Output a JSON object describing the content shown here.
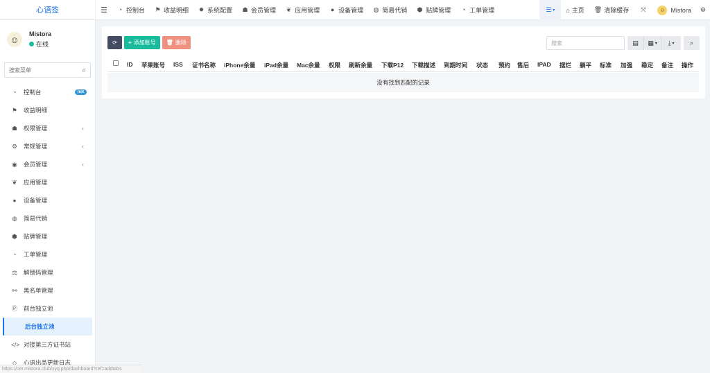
{
  "brand": "心语签",
  "top_nav": [
    {
      "icon": "dashboard-icon",
      "glyph": "◔",
      "label": "控制台"
    },
    {
      "icon": "flag-icon",
      "glyph": "⚑",
      "label": "收益明细"
    },
    {
      "icon": "gear-icon",
      "glyph": "✹",
      "label": "系统配置"
    },
    {
      "icon": "users-icon",
      "glyph": "☗",
      "label": "会员管理"
    },
    {
      "icon": "leaf-icon",
      "glyph": "❦",
      "label": "应用管理"
    },
    {
      "icon": "circle-icon",
      "glyph": "●",
      "label": "设备管理"
    },
    {
      "icon": "dribbble-icon",
      "glyph": "◍",
      "label": "简易代销"
    },
    {
      "icon": "tags-icon",
      "glyph": "⬢",
      "label": "贴牌管理"
    },
    {
      "icon": "dashboard-icon",
      "glyph": "◔",
      "label": "工单管理"
    }
  ],
  "top_right": {
    "home_label": "主页",
    "clear_cache_label": "清除缓存",
    "username": "Mistora"
  },
  "user": {
    "name": "Mistora",
    "status": "在线"
  },
  "sidebar_search": {
    "placeholder": "搜索菜单"
  },
  "sidebar_items": [
    {
      "icon": "dashboard-icon",
      "glyph": "◔",
      "label": "控制台",
      "badge": "hot",
      "arrow": ""
    },
    {
      "icon": "flag-icon",
      "glyph": "⚑",
      "label": "收益明细",
      "badge": "",
      "arrow": ""
    },
    {
      "icon": "users-icon",
      "glyph": "☗",
      "label": "权限管理",
      "badge": "",
      "arrow": "‹"
    },
    {
      "icon": "cogs-icon",
      "glyph": "⚙",
      "label": "常规管理",
      "badge": "",
      "arrow": "‹"
    },
    {
      "icon": "user-circle-icon",
      "glyph": "◉",
      "label": "会员管理",
      "badge": "",
      "arrow": "‹"
    },
    {
      "icon": "leaf-icon",
      "glyph": "❦",
      "label": "应用管理",
      "badge": "",
      "arrow": ""
    },
    {
      "icon": "circle-icon",
      "glyph": "●",
      "label": "设备管理",
      "badge": "",
      "arrow": ""
    },
    {
      "icon": "dribbble-icon",
      "glyph": "◍",
      "label": "简易代销",
      "badge": "",
      "arrow": ""
    },
    {
      "icon": "tags-icon",
      "glyph": "⬢",
      "label": "贴牌管理",
      "badge": "",
      "arrow": ""
    },
    {
      "icon": "dashboard-icon",
      "glyph": "◔",
      "label": "工单管理",
      "badge": "",
      "arrow": ""
    },
    {
      "icon": "balance-scale-icon",
      "glyph": "⚖",
      "label": "解锁码管理",
      "badge": "",
      "arrow": ""
    },
    {
      "icon": "bicycle-icon",
      "glyph": "⚯",
      "label": "黑名单管理",
      "badge": "",
      "arrow": ""
    },
    {
      "icon": "product-hunt-icon",
      "glyph": "Ⓟ",
      "label": "前台独立池",
      "badge": "",
      "arrow": ""
    },
    {
      "icon": "apple-icon",
      "glyph": "",
      "label": "后台独立池",
      "badge": "",
      "arrow": "",
      "active": true
    },
    {
      "icon": "code-icon",
      "glyph": "</>",
      "label": "对接第三方证书站",
      "badge": "",
      "arrow": ""
    },
    {
      "icon": "code-fork-icon",
      "glyph": "◇",
      "label": "心语出品更新日志",
      "badge": "",
      "arrow": ""
    }
  ],
  "toolbar": {
    "add_label": "添加账号",
    "delete_label": "删除",
    "search_placeholder": "搜索"
  },
  "table": {
    "columns": [
      "ID",
      "苹果账号",
      "ISS",
      "证书名称",
      "iPhone余量",
      "iPad余量",
      "Mac余量",
      "权限",
      "刷新余量",
      "下载P12",
      "下载描述",
      "到期时间",
      "状态",
      "预约",
      "售后",
      "IPAD",
      "摆烂",
      "躺平",
      "标准",
      "加强",
      "稳定",
      "备注",
      "操作"
    ],
    "empty_text": "没有找到匹配的记录"
  },
  "status_bar_url": "https://cer.mistora.club/xyq.php/dashboard?ref=addtabs"
}
